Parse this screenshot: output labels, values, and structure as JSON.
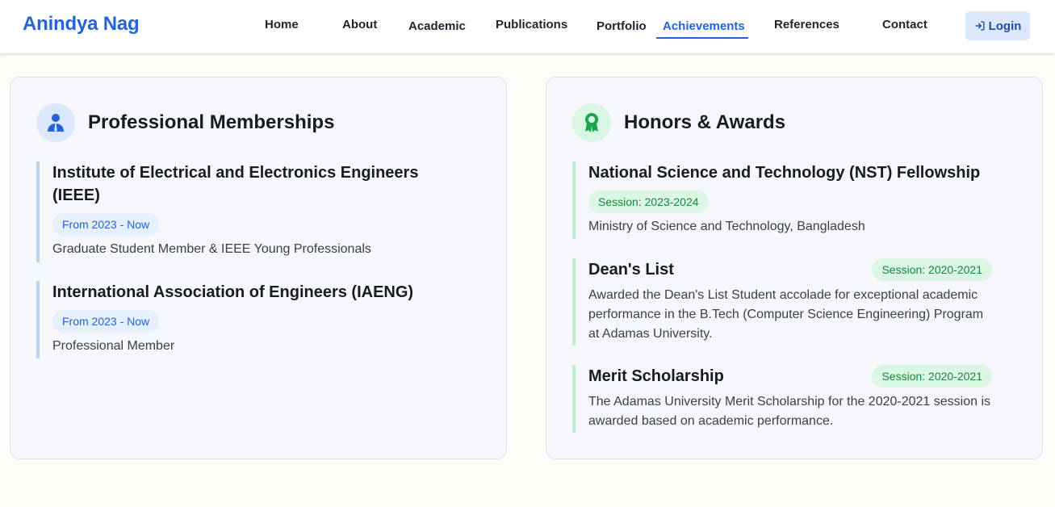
{
  "header": {
    "brand": "Anindya Nag",
    "nav": [
      "Home",
      "About",
      "Academic",
      "Publications",
      "Portfolio",
      "Achievements",
      "References",
      "Contact"
    ],
    "active_nav": "Achievements",
    "login_label": "Login"
  },
  "memberships": {
    "title": "Professional Memberships",
    "icon": "user-tie-icon",
    "items": [
      {
        "title": "Institute of Electrical and Electronics Engineers (IEEE)",
        "period": "From 2023 - Now",
        "description": "Graduate Student Member & IEEE Young Professionals"
      },
      {
        "title": "International Association of Engineers (IAENG)",
        "period": "From 2023 - Now",
        "description": "Professional Member"
      }
    ]
  },
  "awards": {
    "title": "Honors & Awards",
    "icon": "award-ribbon-icon",
    "items": [
      {
        "title": "National Science and Technology (NST) Fellowship",
        "session": "Session: 2023-2024",
        "description": "Ministry of Science and Technology, Bangladesh"
      },
      {
        "title": "Dean's List",
        "session": "Session: 2020-2021",
        "description": "Awarded the Dean's List Student accolade for exceptional academic performance in the B.Tech (Computer Science Engineering) Program at Adamas University."
      },
      {
        "title": "Merit Scholarship",
        "session": "Session: 2020-2021",
        "description": "The Adamas University Merit Scholarship for the 2020-2021 session is awarded based on academic performance."
      }
    ]
  },
  "colors": {
    "accent_blue": "#2563d9",
    "accent_green": "#16883f",
    "page_background": "#fffdf7"
  }
}
